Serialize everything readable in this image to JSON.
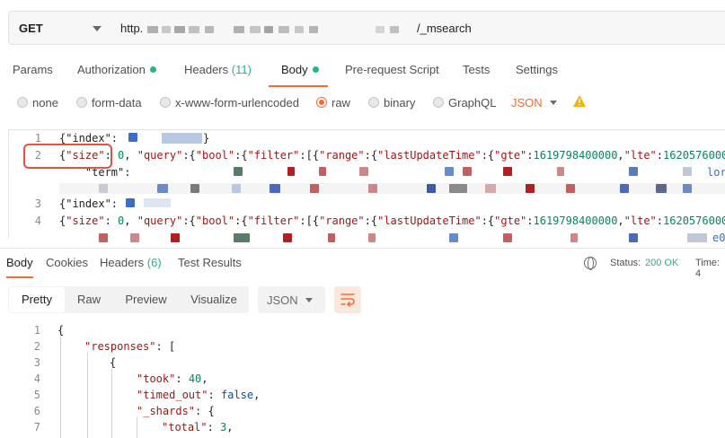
{
  "request": {
    "method": "GET",
    "url_prefix": "http.",
    "url_suffix": "/_msearch"
  },
  "request_tabs": [
    {
      "label": "Params"
    },
    {
      "label": "Authorization"
    },
    {
      "label": "Headers",
      "count": "(11)"
    },
    {
      "label": "Body"
    },
    {
      "label": "Pre-request Script"
    },
    {
      "label": "Tests"
    },
    {
      "label": "Settings"
    }
  ],
  "body_types": [
    {
      "label": "none"
    },
    {
      "label": "form-data"
    },
    {
      "label": "x-www-form-urlencoded"
    },
    {
      "label": "raw"
    },
    {
      "label": "binary"
    },
    {
      "label": "GraphQL"
    }
  ],
  "raw_format": "JSON",
  "warning_icon": "warning-icon",
  "request_body": {
    "lines": [
      {
        "num": "1",
        "text": "{\"index\":"
      },
      {
        "num": "2",
        "text": "{\"size\": 0, \"query\":{\"bool\":{\"filter\":[{\"range\":{\"lastUpdateTime\":{\"gte\":1619798400000,\"lte\":1620576000"
      },
      {
        "num": "",
        "text": "    \"term\":"
      },
      {
        "num": "3",
        "text": "{\"index\":"
      },
      {
        "num": "4",
        "text": "{\"size\": 0, \"query\":{\"bool\":{\"filter\":[{\"range\":{\"lastUpdateTime\":{\"gte\":1619798400000,\"lte\":1620576000"
      }
    ]
  },
  "response_tabs": [
    {
      "label": "Body"
    },
    {
      "label": "Cookies"
    },
    {
      "label": "Headers",
      "count": "(6)"
    },
    {
      "label": "Test Results"
    }
  ],
  "response_status": {
    "status_label": "Status:",
    "status_value": "200 OK",
    "time_label": "Time: 4"
  },
  "view_modes": [
    "Pretty",
    "Raw",
    "Preview",
    "Visualize"
  ],
  "response_format": "JSON",
  "response_body": {
    "line_numbers": [
      "1",
      "2",
      "3",
      "4",
      "5",
      "6",
      "7"
    ],
    "lines": [
      {
        "indent": 0,
        "text": "{"
      },
      {
        "indent": 1,
        "key": "\"responses\"",
        "rest": ": ["
      },
      {
        "indent": 2,
        "text": "{"
      },
      {
        "indent": 3,
        "key": "\"took\"",
        "rest": ": ",
        "num": "40",
        "tail": ","
      },
      {
        "indent": 3,
        "key": "\"timed_out\"",
        "rest": ": ",
        "num": "false",
        "tail": ","
      },
      {
        "indent": 3,
        "key": "\"_shards\"",
        "rest": ": {"
      },
      {
        "indent": 4,
        "key": "\"total\"",
        "rest": ": ",
        "num": "3",
        "tail": ","
      }
    ]
  },
  "colors": {
    "accent": "#f26b3a",
    "green": "#26b47f",
    "highlight_box": "#e0533f",
    "json_key": "#a31515",
    "json_number": "#098658"
  }
}
